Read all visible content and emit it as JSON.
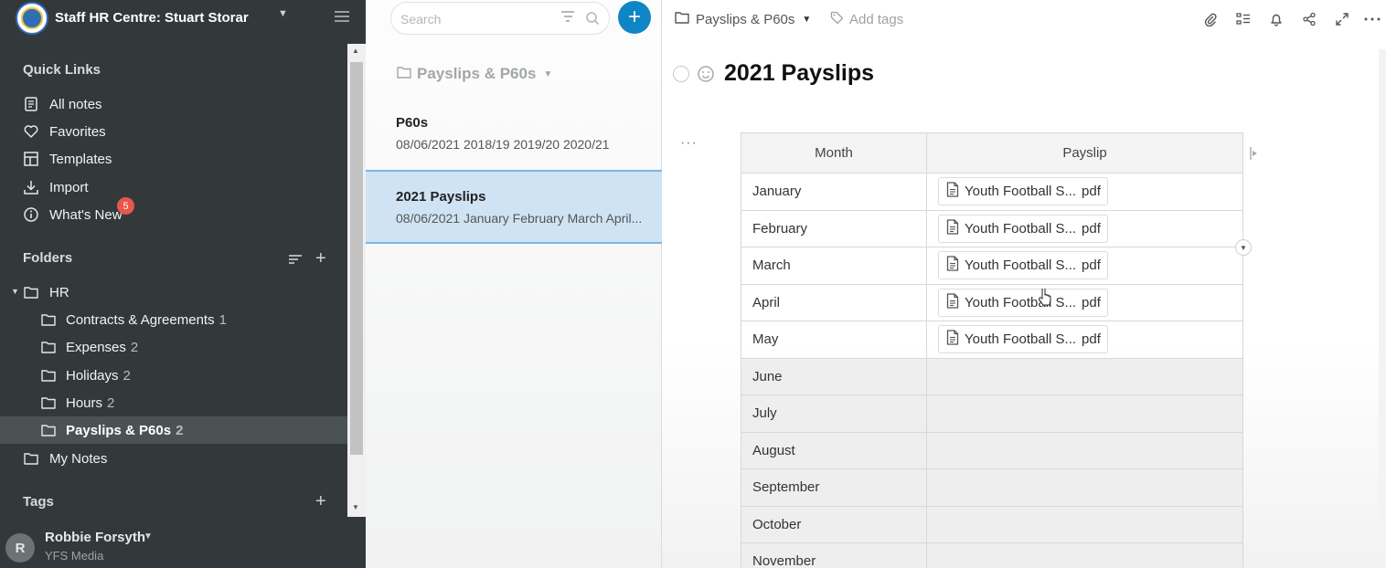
{
  "sidebar": {
    "workspace_title": "Staff HR Centre: Stuart Storar",
    "quick_links_label": "Quick Links",
    "quick_links": [
      {
        "label": "All notes",
        "icon": "note-icon"
      },
      {
        "label": "Favorites",
        "icon": "heart-icon"
      },
      {
        "label": "Templates",
        "icon": "template-icon"
      },
      {
        "label": "Import",
        "icon": "download-icon"
      },
      {
        "label": "What's New",
        "icon": "info-icon",
        "badge": "5"
      }
    ],
    "folders_label": "Folders",
    "folders": [
      {
        "label": "HR",
        "count": ""
      },
      {
        "label": "Contracts & Agreements",
        "count": "1"
      },
      {
        "label": "Expenses",
        "count": "2"
      },
      {
        "label": "Holidays",
        "count": "2"
      },
      {
        "label": "Hours",
        "count": "2"
      },
      {
        "label": "Payslips & P60s",
        "count": "2"
      },
      {
        "label": "My Notes",
        "count": ""
      }
    ],
    "tags_label": "Tags",
    "user": {
      "initial": "R",
      "name": "Robbie Forsyth",
      "org": "YFS Media"
    }
  },
  "notelist": {
    "search_placeholder": "Search",
    "folder_title": "Payslips & P60s",
    "notes": [
      {
        "title": "P60s",
        "snippet": "08/06/2021 2018/19 2019/20 2020/21"
      },
      {
        "title": "2021 Payslips",
        "snippet": "08/06/2021 January February March April..."
      }
    ]
  },
  "editor": {
    "breadcrumb": "Payslips & P60s",
    "add_tags": "Add tags",
    "title": "2021 Payslips",
    "table": {
      "headers": [
        "Month",
        "Payslip"
      ],
      "rows": [
        {
          "month": "January",
          "file": "Youth Football S...",
          "ext": "pdf"
        },
        {
          "month": "February",
          "file": "Youth Football S...",
          "ext": "pdf"
        },
        {
          "month": "March",
          "file": "Youth Football S...",
          "ext": "pdf"
        },
        {
          "month": "April",
          "file": "Youth Football S...",
          "ext": "pdf"
        },
        {
          "month": "May",
          "file": "Youth Football S...",
          "ext": "pdf"
        },
        {
          "month": "June",
          "file": "",
          "ext": ""
        },
        {
          "month": "July",
          "file": "",
          "ext": ""
        },
        {
          "month": "August",
          "file": "",
          "ext": ""
        },
        {
          "month": "September",
          "file": "",
          "ext": ""
        },
        {
          "month": "October",
          "file": "",
          "ext": ""
        },
        {
          "month": "November",
          "file": "",
          "ext": ""
        }
      ]
    }
  },
  "colors": {
    "sidebar_bg": "#33393b",
    "accent": "#0e86c5",
    "selected_note": "#cfe3f4",
    "badge": "#e8574a"
  }
}
